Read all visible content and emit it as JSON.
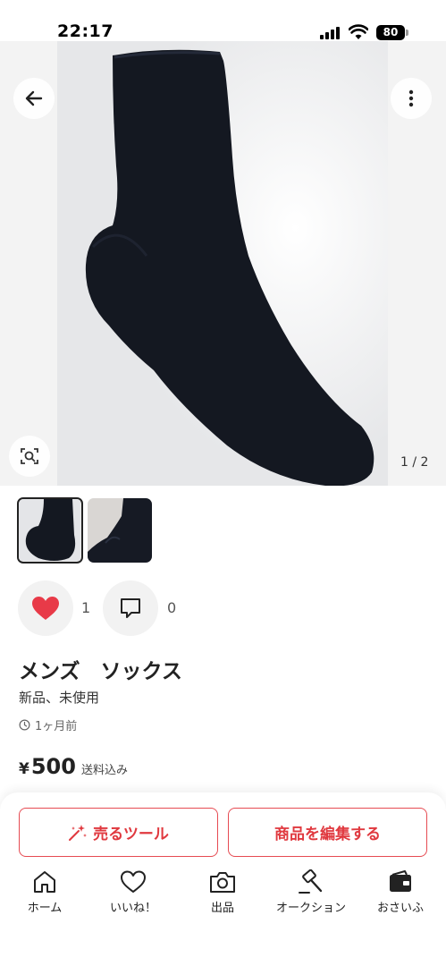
{
  "status_bar": {
    "time": "22:17",
    "battery": "80"
  },
  "photo": {
    "page_counter": "1 / 2",
    "current_index": 1,
    "total": 2
  },
  "reactions": {
    "likes": "1",
    "comments": "0"
  },
  "item": {
    "title": "メンズ　ソックス",
    "condition": "新品、未使用",
    "posted": "1ヶ月前",
    "currency": "¥",
    "price": "500",
    "shipping": "送料込み"
  },
  "actions": {
    "sell_tool": "売るツール",
    "edit": "商品を編集する"
  },
  "tabs": [
    {
      "label": "ホーム",
      "icon": "home-icon"
    },
    {
      "label": "いいね！",
      "icon": "heart-outline-icon"
    },
    {
      "label": "出品",
      "icon": "camera-icon"
    },
    {
      "label": "オークション",
      "icon": "gavel-icon"
    },
    {
      "label": "おさいふ",
      "icon": "wallet-icon"
    }
  ],
  "colors": {
    "accent": "#e0393f",
    "heart": "#e83a48",
    "sock": "#141821"
  }
}
